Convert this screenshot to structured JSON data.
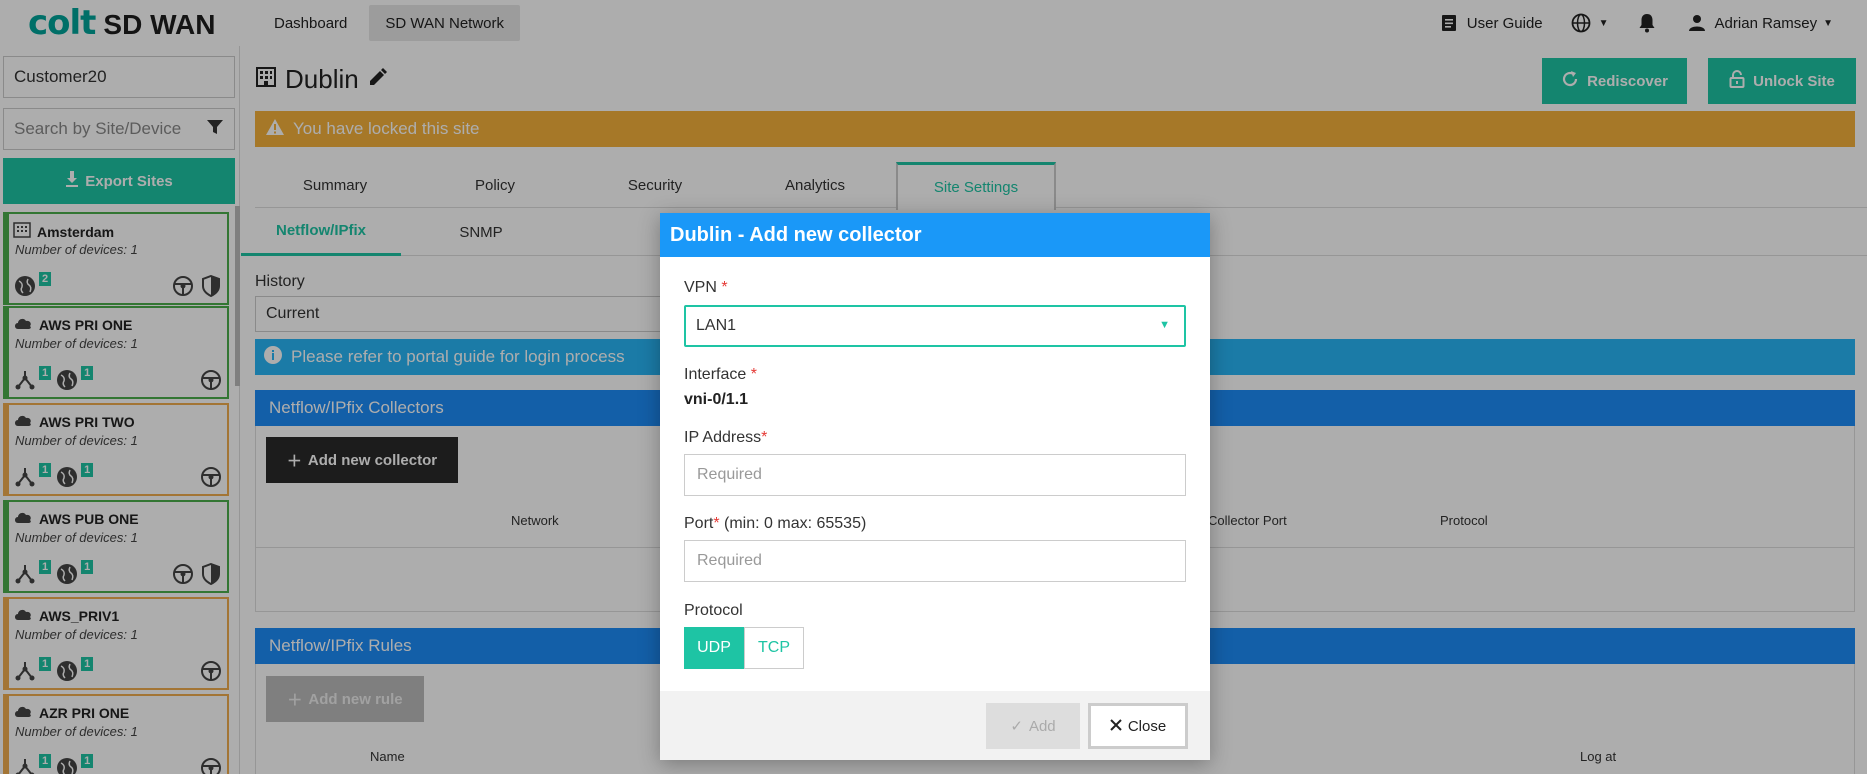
{
  "nav": {
    "brand_colt": "colt",
    "brand_sdwan": "SD WAN",
    "links": [
      "Dashboard",
      "SD WAN Network"
    ],
    "user_guide": "User Guide",
    "user_name": "Adrian Ramsey"
  },
  "sidebar": {
    "customer": "Customer20",
    "search_placeholder": "Search by Site/Device",
    "export_label": "Export Sites",
    "sites": [
      {
        "name": "Amsterdam",
        "devices": "Number of devices: 1",
        "badge_globe": "2",
        "status": "green"
      },
      {
        "name": "AWS PRI ONE",
        "devices": "Number of devices: 1",
        "badge_net": "1",
        "badge_globe": "1",
        "status": "green"
      },
      {
        "name": "AWS PRI TWO",
        "devices": "Number of devices: 1",
        "badge_net": "1",
        "badge_globe": "1",
        "status": "orange"
      },
      {
        "name": "AWS PUB ONE",
        "devices": "Number of devices: 1",
        "badge_net": "1",
        "badge_globe": "1",
        "status": "green"
      },
      {
        "name": "AWS_PRIV1",
        "devices": "Number of devices: 1",
        "badge_net": "1",
        "badge_globe": "1",
        "status": "orange"
      },
      {
        "name": "AZR PRI ONE",
        "devices": "Number of devices: 1",
        "badge_net": "1",
        "badge_globe": "1",
        "status": "orange"
      }
    ]
  },
  "main": {
    "title": "Dublin",
    "rediscover_label": "Rediscover",
    "unlock_label": "Unlock Site",
    "lock_banner": "You have locked this site",
    "tabs": [
      "Summary",
      "Policy",
      "Security",
      "Analytics",
      "Site Settings"
    ],
    "subtabs": [
      "Netflow/IPfix",
      "SNMP"
    ],
    "history_label": "History",
    "history_value": "Current",
    "info_banner": "Please refer to portal guide for login process",
    "collectors_title": "Netflow/IPfix Collectors",
    "add_collector_label": "Add new collector",
    "collector_columns": [
      "Network",
      "Collector Port",
      "Protocol"
    ],
    "rules_title": "Netflow/IPfix Rules",
    "add_rule_label": "Add new rule",
    "rule_columns": [
      "Name",
      "Log at"
    ]
  },
  "modal": {
    "title": "Dublin - Add new collector",
    "vpn_label": "VPN",
    "vpn_value": "LAN1",
    "interface_label": "Interface",
    "interface_value": "vni-0/1.1",
    "ip_label": "IP Address",
    "ip_placeholder": "Required",
    "port_label": "Port",
    "port_hint": " (min: 0 max: 65535)",
    "port_placeholder": "Required",
    "protocol_label": "Protocol",
    "protocol_options": [
      "UDP",
      "TCP"
    ],
    "protocol_selected": "UDP",
    "add_label": "Add",
    "close_label": "Close",
    "required_mark": "*"
  },
  "colors": {
    "accent": "#1ec4a4",
    "brand": "#00a49a",
    "header_blue": "#1d8cf8",
    "warning": "#f5b23b",
    "info": "#29b6f6"
  }
}
